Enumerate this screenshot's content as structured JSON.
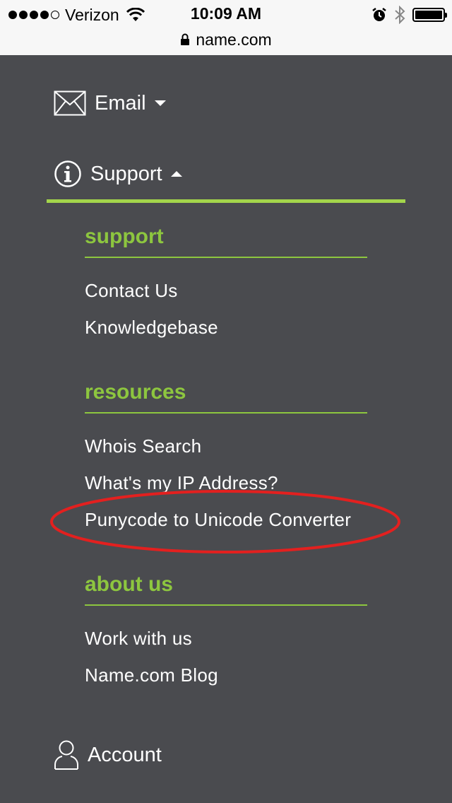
{
  "status_bar": {
    "carrier": "Verizon",
    "time": "10:09 AM",
    "signal_bars_filled": 4,
    "signal_bars_total": 5
  },
  "url_bar": {
    "domain": "name.com"
  },
  "nav": {
    "email": {
      "label": "Email",
      "icon": "envelope-icon"
    },
    "support": {
      "label": "Support",
      "icon": "info-icon"
    },
    "account": {
      "label": "Account",
      "icon": "user-icon"
    }
  },
  "sections": [
    {
      "title": "support",
      "links": [
        "Contact Us",
        "Knowledgebase"
      ]
    },
    {
      "title": "resources",
      "links": [
        "Whois Search",
        "What's my IP Address?",
        "Punycode to Unicode Converter"
      ]
    },
    {
      "title": "about us",
      "links": [
        "Work with us",
        "Name.com Blog"
      ]
    }
  ],
  "colors": {
    "background": "#4a4b4f",
    "accent_green": "#8dc63f",
    "support_rule": "#a3d54b",
    "highlight_ring": "#e3201f"
  }
}
